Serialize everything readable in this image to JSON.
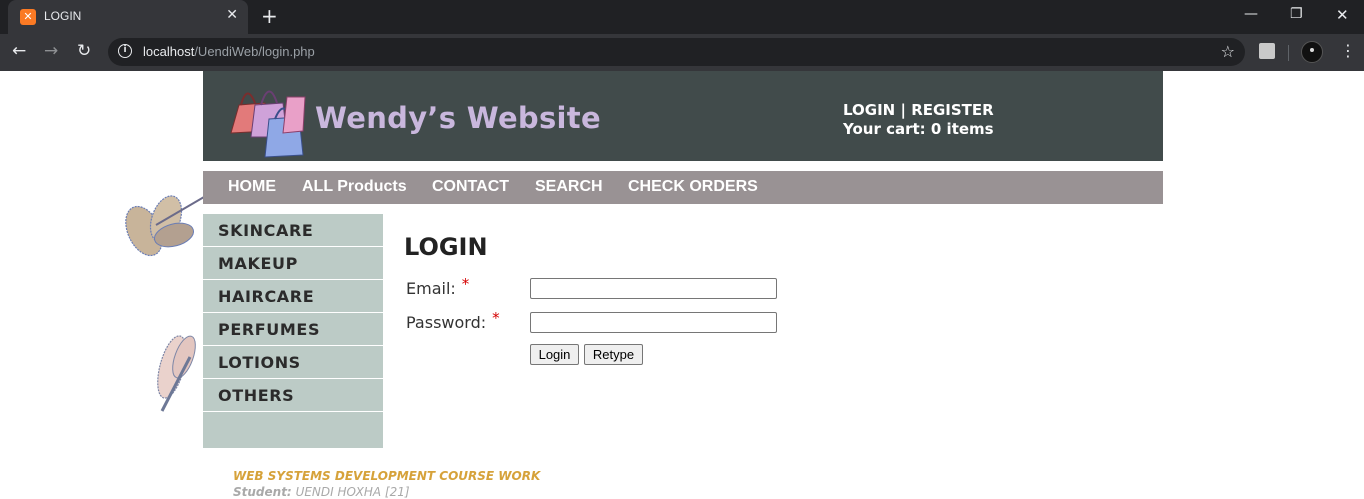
{
  "browser": {
    "tab_title": "LOGIN",
    "tab_close": "✕",
    "new_tab": "+",
    "url_host": "localhost",
    "url_path": "/UendiWeb/login.php",
    "win_min": "—",
    "win_max": "❐",
    "win_close": "✕",
    "icons": [
      "xampp-favicon",
      "back-icon",
      "forward-icon",
      "reload-icon",
      "info-icon",
      "star-icon",
      "extension-icon",
      "profile-icon",
      "menu-icon"
    ]
  },
  "header": {
    "site_name": "Wendy’s Website",
    "login_link": "LOGIN",
    "separator": "|",
    "register_link": "REGISTER",
    "cart_text": "Your cart: 0 items"
  },
  "nav": {
    "items": [
      "HOME",
      "ALL Products",
      "CONTACT",
      "SEARCH",
      "CHECK ORDERS"
    ]
  },
  "sidebar": {
    "items": [
      "SKINCARE",
      "MAKEUP",
      "HAIRCARE",
      "PERFUMES",
      "LOTIONS",
      "OTHERS"
    ]
  },
  "login": {
    "title": "LOGIN",
    "email_label": "Email:",
    "password_label": "Password:",
    "required_mark": "*",
    "email_value": "",
    "password_value": "",
    "login_button": "Login",
    "retype_button": "Retype"
  },
  "footer": {
    "course": "WEB SYSTEMS DEVELOPMENT COURSE WORK",
    "student_label": "Student:",
    "student_name": "UENDI HOXHA [21]"
  },
  "colors": {
    "header_bg": "#414b4b",
    "nav_bg": "#999294",
    "sidebar_bg": "#bccbc6",
    "site_name": "#c9b7dd",
    "footer_title": "#d6a23a"
  }
}
